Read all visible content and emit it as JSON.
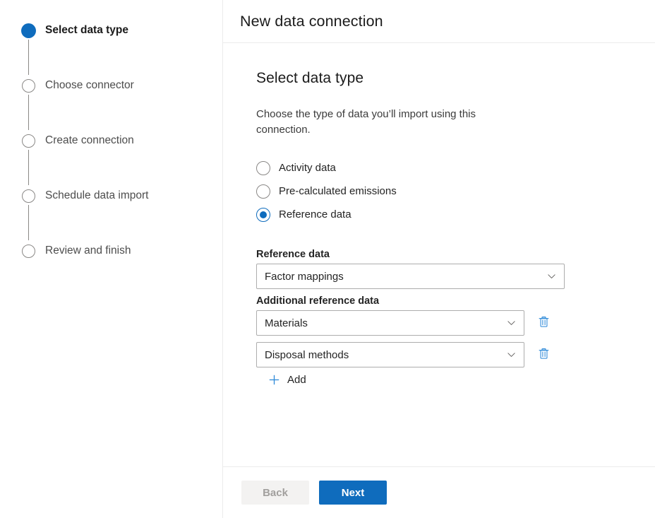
{
  "colors": {
    "accent": "#0f6cbd",
    "border": "#adadad",
    "divider": "#ebebeb",
    "inactive_step": "#8a8886",
    "disabled_button_bg": "#f3f2f1",
    "disabled_button_text": "#a19f9d",
    "text_primary": "#242424",
    "text_secondary": "#4d4d4d"
  },
  "stepper": {
    "steps": [
      {
        "label": "Select data type",
        "state": "current"
      },
      {
        "label": "Choose connector",
        "state": "upcoming"
      },
      {
        "label": "Create connection",
        "state": "upcoming"
      },
      {
        "label": "Schedule data import",
        "state": "upcoming"
      },
      {
        "label": "Review and finish",
        "state": "upcoming"
      }
    ]
  },
  "panel": {
    "title": "New data connection",
    "heading": "Select data type",
    "description": "Choose the type of data you’ll import using this connection."
  },
  "data_type": {
    "options": [
      {
        "label": "Activity data",
        "selected": false
      },
      {
        "label": "Pre-calculated emissions",
        "selected": false
      },
      {
        "label": "Reference data",
        "selected": true
      }
    ]
  },
  "reference_data": {
    "label": "Reference data",
    "value": "Factor mappings"
  },
  "additional_reference_data": {
    "label": "Additional reference data",
    "rows": [
      {
        "value": "Materials",
        "delete_icon": "trash-icon"
      },
      {
        "value": "Disposal methods",
        "delete_icon": "trash-icon"
      }
    ],
    "add_label": "Add",
    "add_icon": "plus-icon"
  },
  "footer": {
    "back_label": "Back",
    "next_label": "Next"
  },
  "icons": {
    "chevron": "chevron-down-icon",
    "trash": "trash-icon",
    "plus": "plus-icon"
  }
}
